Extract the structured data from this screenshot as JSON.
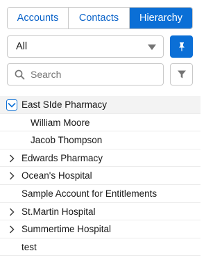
{
  "tabs": [
    {
      "label": "Accounts",
      "active": false
    },
    {
      "label": "Contacts",
      "active": false
    },
    {
      "label": "Hierarchy",
      "active": true
    }
  ],
  "filter_select": {
    "value": "All"
  },
  "search": {
    "placeholder": "Search",
    "value": ""
  },
  "tree": [
    {
      "label": "East SIde Pharmacy",
      "state": "expanded",
      "level": 0
    },
    {
      "label": "William Moore",
      "state": "leaf",
      "level": 1
    },
    {
      "label": "Jacob Thompson",
      "state": "leaf",
      "level": 1
    },
    {
      "label": "Edwards Pharmacy",
      "state": "collapsed",
      "level": 0
    },
    {
      "label": "Ocean's Hospital",
      "state": "collapsed",
      "level": 0
    },
    {
      "label": "Sample Account for Entitlements",
      "state": "leaf",
      "level": 0
    },
    {
      "label": "St.Martin Hospital",
      "state": "collapsed",
      "level": 0
    },
    {
      "label": "Summertime Hospital",
      "state": "collapsed",
      "level": 0
    },
    {
      "label": "test",
      "state": "leaf",
      "level": 0
    }
  ],
  "icons": {
    "pin": "pin-icon",
    "search": "search-icon",
    "filter": "filter-icon",
    "expand": "chevron-right-icon",
    "collapse": "chevron-down-icon"
  },
  "colors": {
    "brand": "#0b6fd6",
    "tab_text": "#0a63c9",
    "border": "#c9c9c9",
    "selected_row": "#f3f3f3"
  }
}
